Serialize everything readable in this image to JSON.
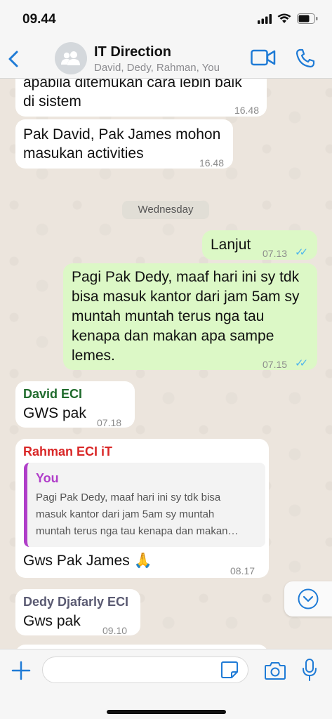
{
  "status_bar": {
    "time": "09.44"
  },
  "header": {
    "back_icon": "chevron-left-icon",
    "title": "IT Direction",
    "participants": "David, Dedy, Rahman, You"
  },
  "messages": {
    "m1": {
      "text_line1": "apabila ditemukan cara lebih baik",
      "text_line2": "di sistem",
      "time": "16.48"
    },
    "m2": {
      "text_line1": "Pak David, Pak James mohon",
      "text_line2": "masukan activities",
      "time": "16.48"
    },
    "day_separator": "Wednesday",
    "m3": {
      "text": "Lanjut",
      "time": "07.13"
    },
    "m4": {
      "line1": "Pagi Pak Dedy, maaf hari ini sy tdk",
      "line2": "bisa masuk kantor dari jam 5am sy",
      "line3": "muntah muntah terus nga tau",
      "line4": "kenapa dan makan apa sampe",
      "line5": "lemes.",
      "time": "07.15"
    },
    "m5": {
      "sender": "David ECI",
      "text": "GWS pak",
      "time": "07.18"
    },
    "m6": {
      "sender": "Rahman ECI iT",
      "quote_name": "You",
      "quote_line1": "Pagi Pak Dedy, maaf hari ini sy tdk bisa",
      "quote_line2": "masuk kantor dari jam 5am sy muntah",
      "quote_line3": "muntah terus nga tau kenapa dan makan…",
      "text": "Gws Pak James 🙏",
      "time": "08.17"
    },
    "m7": {
      "sender": "Dedy Djafarly ECI",
      "text": "Gws pak",
      "time": "09.10"
    }
  },
  "colors": {
    "accent": "#1f7bd6",
    "outgoing_bubble": "#dcf8c6",
    "incoming_bubble": "#ffffff",
    "read_ticks": "#4fb6ec",
    "sender_david": "#1f6b2c",
    "sender_rahman": "#d92727",
    "sender_dedy": "#5a5a72",
    "quote_you": "#b03ec9"
  },
  "composer": {
    "placeholder": ""
  }
}
